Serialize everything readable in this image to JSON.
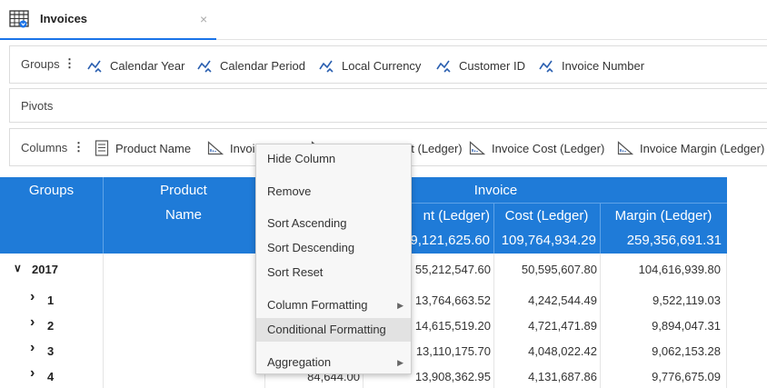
{
  "tab": {
    "title": "Invoices",
    "close": "×",
    "icon": "table-grid-icon"
  },
  "groups": {
    "label": "Groups",
    "kebab": "⋮",
    "items": [
      "Calendar Year",
      "Calendar Period",
      "Local Currency",
      "Customer ID",
      "Invoice Number"
    ]
  },
  "pivots": {
    "label": "Pivots"
  },
  "columns": {
    "label": "Columns",
    "kebab": "⋮",
    "items": [
      "Product Name",
      "Invoice Qty",
      "Invoice Amount (Ledger)",
      "Invoice Cost (Ledger)",
      "Invoice Margin (Ledger)"
    ]
  },
  "table": {
    "headers": {
      "groups": "Groups",
      "product": "Product",
      "product2": "Name",
      "invoice": "Invoice",
      "amount": "nt (Ledger)",
      "cost": "Cost (Ledger)",
      "margin": "Margin (Ledger)"
    },
    "totals": {
      "amount": "9,121,625.60",
      "cost": "109,764,934.29",
      "margin": "259,356,691.31"
    },
    "rows": [
      {
        "label": "2017",
        "chev": "∨",
        "qty": "",
        "amount": "55,212,547.60",
        "cost": "50,595,607.80",
        "margin": "104,616,939.80"
      },
      {
        "label": "1",
        "chev": "›",
        "qty": "",
        "amount": "13,764,663.52",
        "cost": "4,242,544.49",
        "margin": "9,522,119.03"
      },
      {
        "label": "2",
        "chev": "›",
        "qty": "",
        "amount": "14,615,519.20",
        "cost": "4,721,471.89",
        "margin": "9,894,047.31"
      },
      {
        "label": "3",
        "chev": "›",
        "qty": "",
        "amount": "13,110,175.70",
        "cost": "4,048,022.42",
        "margin": "9,062,153.28"
      },
      {
        "label": "4",
        "chev": "›",
        "qty": "84,644.00",
        "amount": "13,908,362.95",
        "cost": "4,131,687.86",
        "margin": "9,776,675.09"
      }
    ]
  },
  "menu": {
    "items": [
      {
        "label": "Hide Column",
        "submenu": ""
      },
      {
        "label": "Remove",
        "submenu": ""
      },
      {
        "label": "Sort Ascending",
        "submenu": ""
      },
      {
        "label": "Sort Descending",
        "submenu": ""
      },
      {
        "label": "Sort Reset",
        "submenu": ""
      },
      {
        "label": "Column Formatting",
        "submenu": "▶"
      },
      {
        "label": "Conditional Formatting",
        "submenu": ""
      },
      {
        "label": "Aggregation",
        "submenu": "▶"
      }
    ]
  }
}
